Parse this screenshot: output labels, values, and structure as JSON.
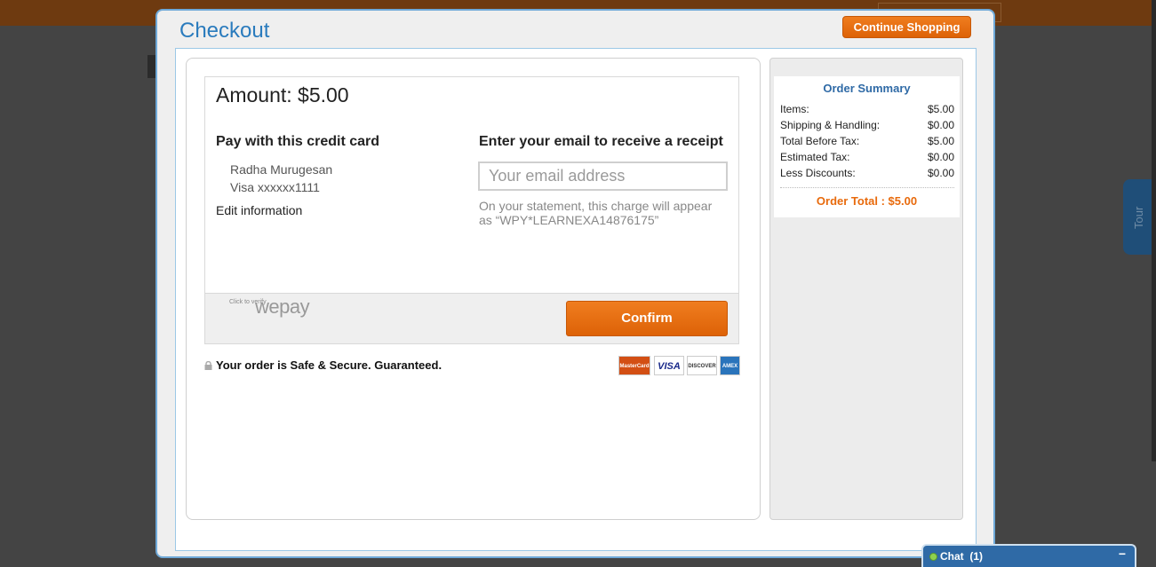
{
  "modal": {
    "title": "Checkout",
    "continue_label": "Continue Shopping"
  },
  "payment": {
    "amount": "Amount: $5.00",
    "card_title": "Pay with this credit card",
    "card_name": "Radha Murugesan",
    "card_number": "Visa xxxxxx1111",
    "edit_label": "Edit information",
    "email_title": "Enter your email to receive a receipt",
    "email_placeholder": "Your email address",
    "statement": "On your statement, this charge will appear as “WPY*LEARNEXA14876175”",
    "verify_text": "Click to verify",
    "provider": "wepay",
    "confirm_label": "Confirm",
    "secure_text": "Your order is Safe & Secure. Guaranteed.",
    "card_logos": [
      "MasterCard",
      "VISA",
      "DISCOVER",
      "AMEX"
    ]
  },
  "summary": {
    "title": "Order Summary",
    "rows": [
      {
        "label": "Items:",
        "value": "$5.00"
      },
      {
        "label": "Shipping & Handling:",
        "value": "$0.00"
      },
      {
        "label": "Total Before Tax:",
        "value": "$5.00"
      },
      {
        "label": "Estimated Tax:",
        "value": "$0.00"
      },
      {
        "label": "Less Discounts:",
        "value": "$0.00"
      }
    ],
    "total": "Order Total : $5.00"
  },
  "background": {
    "tour_label": "Tour"
  },
  "chat": {
    "label": "Chat",
    "count": "(1)",
    "minimize": "−"
  },
  "colors": {
    "accent_orange": "#e86a0c",
    "title_blue": "#2a7bbd",
    "summary_blue": "#2f6aa6"
  }
}
